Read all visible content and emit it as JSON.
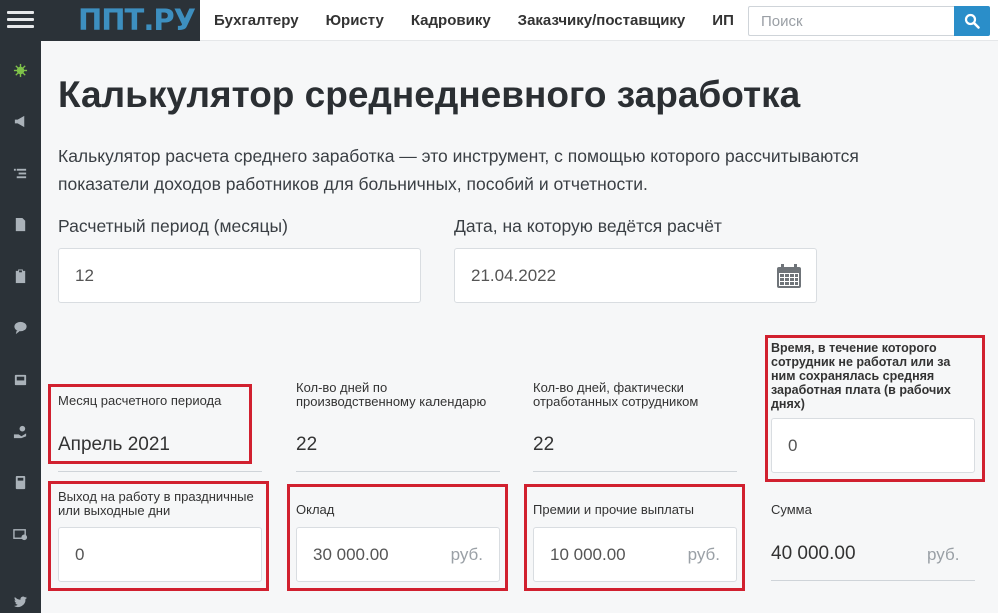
{
  "header": {
    "logo": "ППТ.РУ",
    "nav": [
      "Бухгалтеру",
      "Юристу",
      "Кадровику",
      "Заказчику/поставщику",
      "ИП"
    ],
    "search_placeholder": "Поиск"
  },
  "sidebar": {
    "icons": [
      "virus-icon",
      "megaphone-icon",
      "list-icon",
      "document-icon",
      "clipboard-icon",
      "chat-icon",
      "inbox-icon",
      "hand-coin-icon",
      "calculator-icon",
      "certificate-icon",
      "twitter-icon"
    ]
  },
  "page": {
    "title": "Калькулятор среднедневного заработка",
    "description": "Калькулятор расчета среднего заработка — это инструмент, с помощью которого рассчитываются показатели доходов работников для больничных, пособий и отчетности."
  },
  "form": {
    "period_label": "Расчетный период (месяцы)",
    "period_value": "12",
    "date_label": "Дата, на которую ведётся расчёт",
    "date_value": "21.04.2022",
    "month_label": "Месяц расчетного периода",
    "month_value": "Апрель 2021",
    "calendar_days_label": "Кол-во дней по производственному календарю",
    "calendar_days_value": "22",
    "worked_days_label": "Кол-во дней, фактически отработанных сотрудником",
    "worked_days_value": "22",
    "absence_label": "Время, в течение которого сотрудник не работал или за ним сохранялась средняя заработная плата (в рабочих днях)",
    "absence_value": "0",
    "holiday_label": "Выход на работу в праздничные или выходные дни",
    "holiday_value": "0",
    "salary_label": "Оклад",
    "salary_value": "30 000.00",
    "bonus_label": "Премии и прочие выплаты",
    "bonus_value": "10 000.00",
    "sum_label": "Сумма",
    "sum_value": "40 000.00",
    "currency": "руб."
  },
  "colors": {
    "highlight": "#d1202f",
    "accent": "#2a8ec9",
    "sidebar": "#2b3238"
  }
}
